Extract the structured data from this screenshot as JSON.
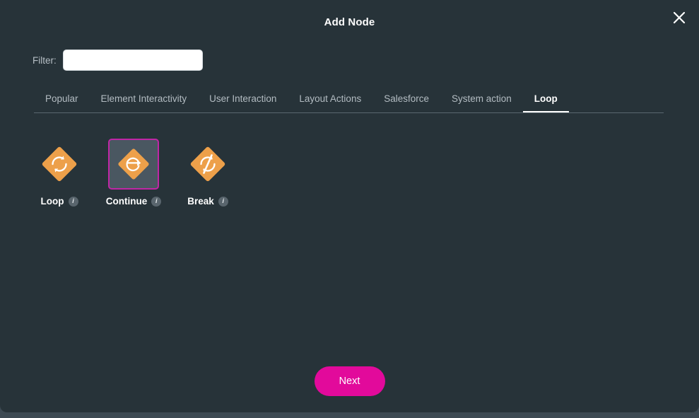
{
  "dialog": {
    "title": "Add Node",
    "close_icon": "close-icon"
  },
  "filter": {
    "label": "Filter:",
    "value": "",
    "placeholder": ""
  },
  "tabs": [
    {
      "label": "Popular",
      "active": false
    },
    {
      "label": "Element Interactivity",
      "active": false
    },
    {
      "label": "User Interaction",
      "active": false
    },
    {
      "label": "Layout Actions",
      "active": false
    },
    {
      "label": "Salesforce",
      "active": false
    },
    {
      "label": "System action",
      "active": false
    },
    {
      "label": "Loop",
      "active": true
    }
  ],
  "nodes": [
    {
      "label": "Loop",
      "icon": "loop-cycle-icon",
      "info_icon": "info-icon",
      "selected": false
    },
    {
      "label": "Continue",
      "icon": "continue-arrow-icon",
      "info_icon": "info-icon",
      "selected": true
    },
    {
      "label": "Break",
      "icon": "break-slash-icon",
      "info_icon": "info-icon",
      "selected": false
    }
  ],
  "footer": {
    "next_label": "Next"
  },
  "colors": {
    "dialog_background": "#273339",
    "page_background": "#3d4a53",
    "accent_magenta": "#e20a9b",
    "selection_border": "#c026a6",
    "node_orange": "#eda04a",
    "tile_selected_background": "#4a5761",
    "divider": "#5a676f",
    "tab_inactive_text": "#b3bcc2",
    "tab_active_text": "#ffffff"
  }
}
